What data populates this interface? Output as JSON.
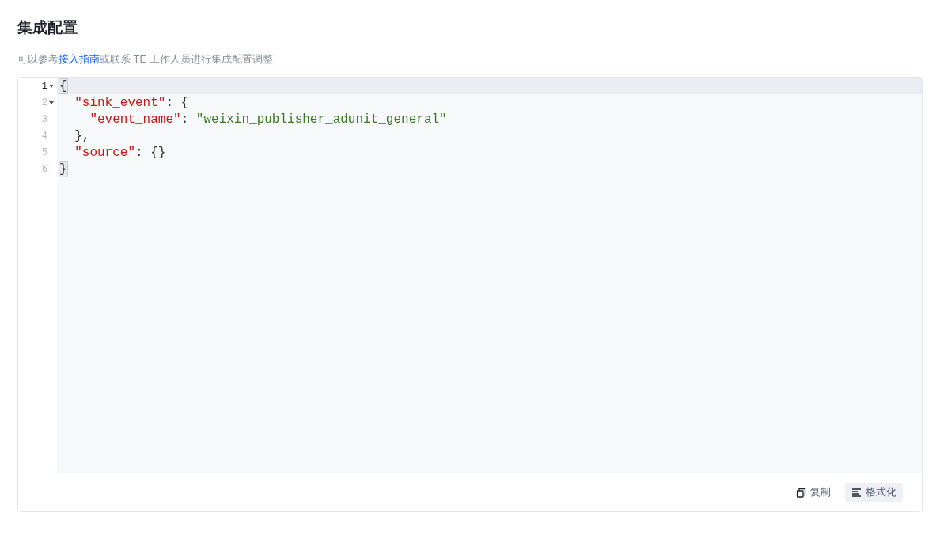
{
  "title": "集成配置",
  "description": {
    "before": "可以参考",
    "link": "接入指南",
    "after": "或联系 TE 工作人员进行集成配置调整"
  },
  "editor": {
    "lines": [
      {
        "number": "1",
        "foldable": true,
        "active": true,
        "tokens": [
          {
            "kind": "bracket-match",
            "text": "{"
          }
        ]
      },
      {
        "number": "2",
        "foldable": true,
        "active": false,
        "tokens": [
          {
            "kind": "key",
            "text": "  \"sink_event\""
          },
          {
            "kind": "punct",
            "text": ": {"
          }
        ]
      },
      {
        "number": "3",
        "foldable": false,
        "active": false,
        "tokens": [
          {
            "kind": "key",
            "text": "    \"event_name\""
          },
          {
            "kind": "punct",
            "text": ": "
          },
          {
            "kind": "string",
            "text": "\"weixin_publisher_adunit_general\""
          }
        ]
      },
      {
        "number": "4",
        "foldable": false,
        "active": false,
        "tokens": [
          {
            "kind": "punct",
            "text": "  },"
          }
        ]
      },
      {
        "number": "5",
        "foldable": false,
        "active": false,
        "tokens": [
          {
            "kind": "key",
            "text": "  \"source\""
          },
          {
            "kind": "punct",
            "text": ": {}"
          }
        ]
      },
      {
        "number": "6",
        "foldable": false,
        "active": false,
        "tokens": [
          {
            "kind": "bracket-match",
            "text": "}"
          }
        ]
      }
    ]
  },
  "actions": [
    {
      "kind": "copy",
      "label": "复制",
      "selected": false
    },
    {
      "kind": "format",
      "label": "格式化",
      "selected": true
    }
  ]
}
